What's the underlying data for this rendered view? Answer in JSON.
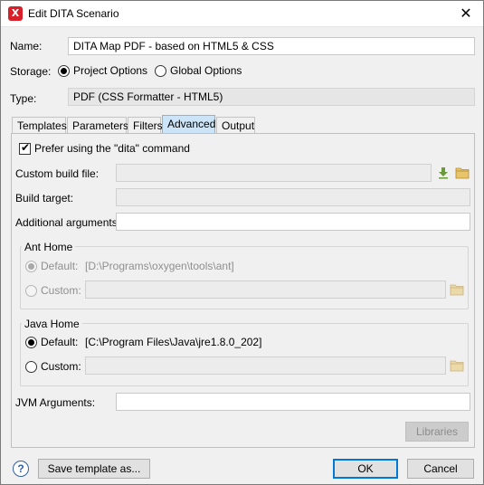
{
  "window": {
    "title": "Edit DITA Scenario",
    "app_icon_glyph": "X",
    "close_glyph": "✕"
  },
  "fields": {
    "name_label": "Name:",
    "name_value": "DITA Map PDF - based on HTML5 & CSS",
    "storage_label": "Storage:",
    "storage_options": [
      "Project Options",
      "Global Options"
    ],
    "storage_selected": "Project Options",
    "type_label": "Type:",
    "type_value": "PDF (CSS Formatter - HTML5)"
  },
  "tabs": [
    {
      "label": "Templates"
    },
    {
      "label": "Parameters"
    },
    {
      "label": "Filters"
    },
    {
      "label": "Advanced",
      "active": true
    },
    {
      "label": "Output"
    }
  ],
  "advanced": {
    "prefer_dita_label": "Prefer using the \"dita\" command",
    "prefer_dita_checked": true,
    "check_glyph": "✔",
    "custom_build_file_label": "Custom build file:",
    "custom_build_file_value": "",
    "build_target_label": "Build target:",
    "build_target_value": "",
    "additional_args_label": "Additional arguments:",
    "additional_args_value": "",
    "ant_home": {
      "title": "Ant Home",
      "default_label": "Default:",
      "default_value": "[D:\\Programs\\oxygen\\tools\\ant]",
      "custom_label": "Custom:",
      "custom_value": "",
      "selected": "Default"
    },
    "java_home": {
      "title": "Java Home",
      "default_label": "Default:",
      "default_value": "[C:\\Program Files\\Java\\jre1.8.0_202]",
      "custom_label": "Custom:",
      "custom_value": "",
      "selected": "Default"
    },
    "jvm_args_label": "JVM Arguments:",
    "jvm_args_value": "",
    "libraries_label": "Libraries"
  },
  "footer": {
    "help_glyph": "?",
    "save_template_label": "Save template as...",
    "ok_label": "OK",
    "cancel_label": "Cancel"
  },
  "colors": {
    "accent": "#0078d7",
    "active_tab": "#cce4f7",
    "folder": "#dcb35c",
    "download_arrow": "#6a9a3a"
  }
}
